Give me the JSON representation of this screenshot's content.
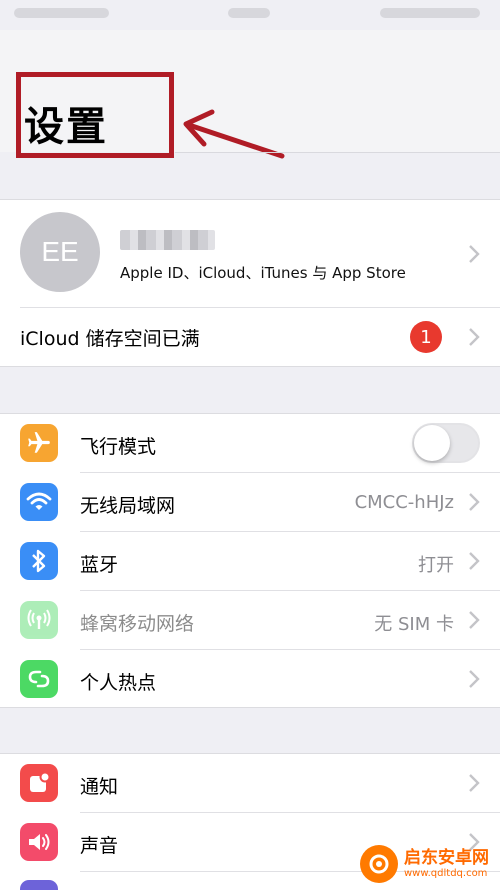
{
  "header": {
    "title": "设置"
  },
  "account": {
    "avatar_initials": "EE",
    "subtitle": "Apple ID、iCloud、iTunes 与 App Store"
  },
  "icloud": {
    "label": "iCloud 储存空间已满",
    "badge": "1"
  },
  "connectivity": [
    {
      "label": "飞行模式",
      "icon": "airplane-icon",
      "color": "#f7a531"
    },
    {
      "label": "无线局域网",
      "value": "CMCC-hHJz",
      "icon": "wifi-icon",
      "color": "#3a8ef6"
    },
    {
      "label": "蓝牙",
      "value": "打开",
      "icon": "bluetooth-icon",
      "color": "#3a8ef6"
    },
    {
      "label": "蜂窝移动网络",
      "value": "无 SIM 卡",
      "icon": "antenna-icon",
      "color": "#4cd964"
    },
    {
      "label": "个人热点",
      "icon": "hotspot-icon",
      "color": "#4cd964"
    }
  ],
  "notifications": [
    {
      "label": "通知",
      "icon": "notifications-icon",
      "color": "#f34b4b"
    },
    {
      "label": "声音",
      "icon": "sound-icon",
      "color": "#f34b6a"
    }
  ],
  "watermark": {
    "name": "启东安卓网",
    "url": "www.qdltdq.com"
  }
}
